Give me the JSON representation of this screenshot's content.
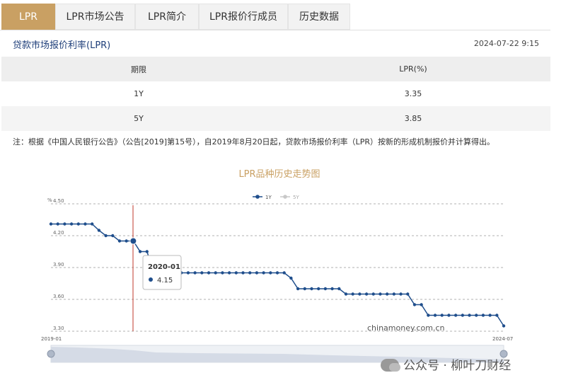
{
  "tabs": [
    {
      "label": "LPR",
      "active": true
    },
    {
      "label": "LPR市场公告",
      "active": false
    },
    {
      "label": "LPR简介",
      "active": false
    },
    {
      "label": "LPR报价行成员",
      "active": false
    },
    {
      "label": "历史数据",
      "active": false
    }
  ],
  "section": {
    "title": "贷款市场报价利率(LPR)",
    "timestamp": "2024-07-22 9:15"
  },
  "table": {
    "headers": [
      "期限",
      "LPR(%)"
    ],
    "rows": [
      [
        "1Y",
        "3.35"
      ],
      [
        "5Y",
        "3.85"
      ]
    ]
  },
  "note": "注：根据《中国人民银行公告》（公告[2019]第15号），自2019年8月20日起，贷款市场报价利率（LPR）按新的形成机制报价并计算得出。",
  "colors": {
    "accent": "#c9a063",
    "series_1y": "#1f4e8c",
    "series_5y": "#c8c8c8"
  },
  "chart_data": {
    "type": "line",
    "title": "LPR品种历史走势图",
    "ylabel": "%",
    "ylim": [
      3.3,
      4.5
    ],
    "yticks": [
      "4.50",
      "4.20",
      "3.90",
      "3.60",
      "3.30"
    ],
    "xrange_labels": [
      "2019-01",
      "2024-07"
    ],
    "legend": [
      "1Y",
      "5Y"
    ],
    "legend_position": "top-right",
    "grid": true,
    "series": [
      {
        "name": "1Y",
        "points": [
          [
            "2019-01",
            4.31
          ],
          [
            "2019-02",
            4.31
          ],
          [
            "2019-03",
            4.31
          ],
          [
            "2019-04",
            4.31
          ],
          [
            "2019-05",
            4.31
          ],
          [
            "2019-06",
            4.31
          ],
          [
            "2019-07",
            4.31
          ],
          [
            "2019-08",
            4.25
          ],
          [
            "2019-09",
            4.2
          ],
          [
            "2019-10",
            4.2
          ],
          [
            "2019-11",
            4.15
          ],
          [
            "2019-12",
            4.15
          ],
          [
            "2020-01",
            4.15
          ],
          [
            "2020-02",
            4.05
          ],
          [
            "2020-03",
            4.05
          ],
          [
            "2020-04",
            3.85
          ],
          [
            "2020-05",
            3.85
          ],
          [
            "2020-06",
            3.85
          ],
          [
            "2020-07",
            3.85
          ],
          [
            "2020-08",
            3.85
          ],
          [
            "2020-09",
            3.85
          ],
          [
            "2020-10",
            3.85
          ],
          [
            "2020-11",
            3.85
          ],
          [
            "2020-12",
            3.85
          ],
          [
            "2021-01",
            3.85
          ],
          [
            "2021-02",
            3.85
          ],
          [
            "2021-03",
            3.85
          ],
          [
            "2021-04",
            3.85
          ],
          [
            "2021-05",
            3.85
          ],
          [
            "2021-06",
            3.85
          ],
          [
            "2021-07",
            3.85
          ],
          [
            "2021-08",
            3.85
          ],
          [
            "2021-09",
            3.85
          ],
          [
            "2021-10",
            3.85
          ],
          [
            "2021-11",
            3.85
          ],
          [
            "2021-12",
            3.8
          ],
          [
            "2022-01",
            3.7
          ],
          [
            "2022-02",
            3.7
          ],
          [
            "2022-03",
            3.7
          ],
          [
            "2022-04",
            3.7
          ],
          [
            "2022-05",
            3.7
          ],
          [
            "2022-06",
            3.7
          ],
          [
            "2022-07",
            3.7
          ],
          [
            "2022-08",
            3.65
          ],
          [
            "2022-09",
            3.65
          ],
          [
            "2022-10",
            3.65
          ],
          [
            "2022-11",
            3.65
          ],
          [
            "2022-12",
            3.65
          ],
          [
            "2023-01",
            3.65
          ],
          [
            "2023-02",
            3.65
          ],
          [
            "2023-03",
            3.65
          ],
          [
            "2023-04",
            3.65
          ],
          [
            "2023-05",
            3.65
          ],
          [
            "2023-06",
            3.55
          ],
          [
            "2023-07",
            3.55
          ],
          [
            "2023-08",
            3.45
          ],
          [
            "2023-09",
            3.45
          ],
          [
            "2023-10",
            3.45
          ],
          [
            "2023-11",
            3.45
          ],
          [
            "2023-12",
            3.45
          ],
          [
            "2024-01",
            3.45
          ],
          [
            "2024-02",
            3.45
          ],
          [
            "2024-03",
            3.45
          ],
          [
            "2024-04",
            3.45
          ],
          [
            "2024-05",
            3.45
          ],
          [
            "2024-06",
            3.45
          ],
          [
            "2024-07",
            3.35
          ]
        ]
      },
      {
        "name": "5Y",
        "points": []
      }
    ],
    "tooltip": {
      "date": "2020-01",
      "value": "4.15"
    },
    "source_text": "chinamoney.com.cn"
  },
  "watermark": "公众号 · 柳叶刀财经"
}
